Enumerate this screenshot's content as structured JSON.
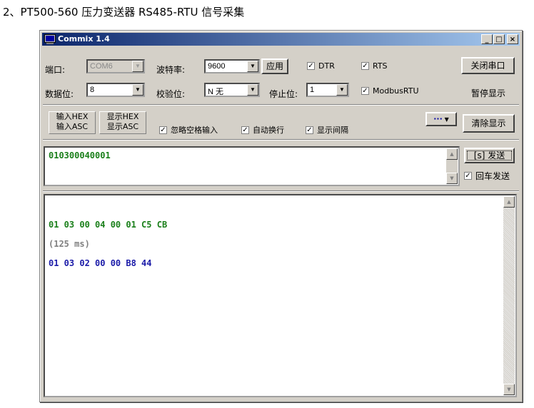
{
  "heading": "2、PT500-560 压力变送器 RS485-RTU 信号采集",
  "window": {
    "title": "Commix 1.4",
    "icon": "terminal-icon",
    "controls": {
      "minimize": "_",
      "maximize": "□",
      "close": "×"
    }
  },
  "settings": {
    "port_label": "端口:",
    "port_value": "COM6",
    "baud_label": "波特率:",
    "baud_value": "9600",
    "apply_button": "应用",
    "dtr_label": "DTR",
    "rts_label": "RTS",
    "close_port_button": "关闭串口",
    "databits_label": "数据位:",
    "databits_value": "8",
    "parity_label": "校验位:",
    "parity_value": "N 无",
    "stopbits_label": "停止位:",
    "stopbits_value": "1",
    "modbus_label": "ModbusRTU",
    "pause_display": "暂停显示"
  },
  "options": {
    "input_hex": "输入HEX",
    "input_asc": "输入ASC",
    "display_hex": "显示HEX",
    "display_asc": "显示ASC",
    "ignore_space": "忽略空格输入",
    "auto_wrap": "自动换行",
    "show_interval": "显示间隔",
    "more_button": "···",
    "clear_display": "清除显示"
  },
  "send": {
    "input_value": "010300040001",
    "send_button": "[s] 发送",
    "enter_send_label": "回车发送"
  },
  "output": {
    "lines": [
      {
        "text": "01 03 00 04 00 01 C5 CB",
        "color": "#1a7f1a"
      },
      {
        "text": "(125 ms)",
        "color": "#808080"
      },
      {
        "text": "01 03 02 00 00 B8 44",
        "color": "#1a1aa8"
      }
    ]
  }
}
